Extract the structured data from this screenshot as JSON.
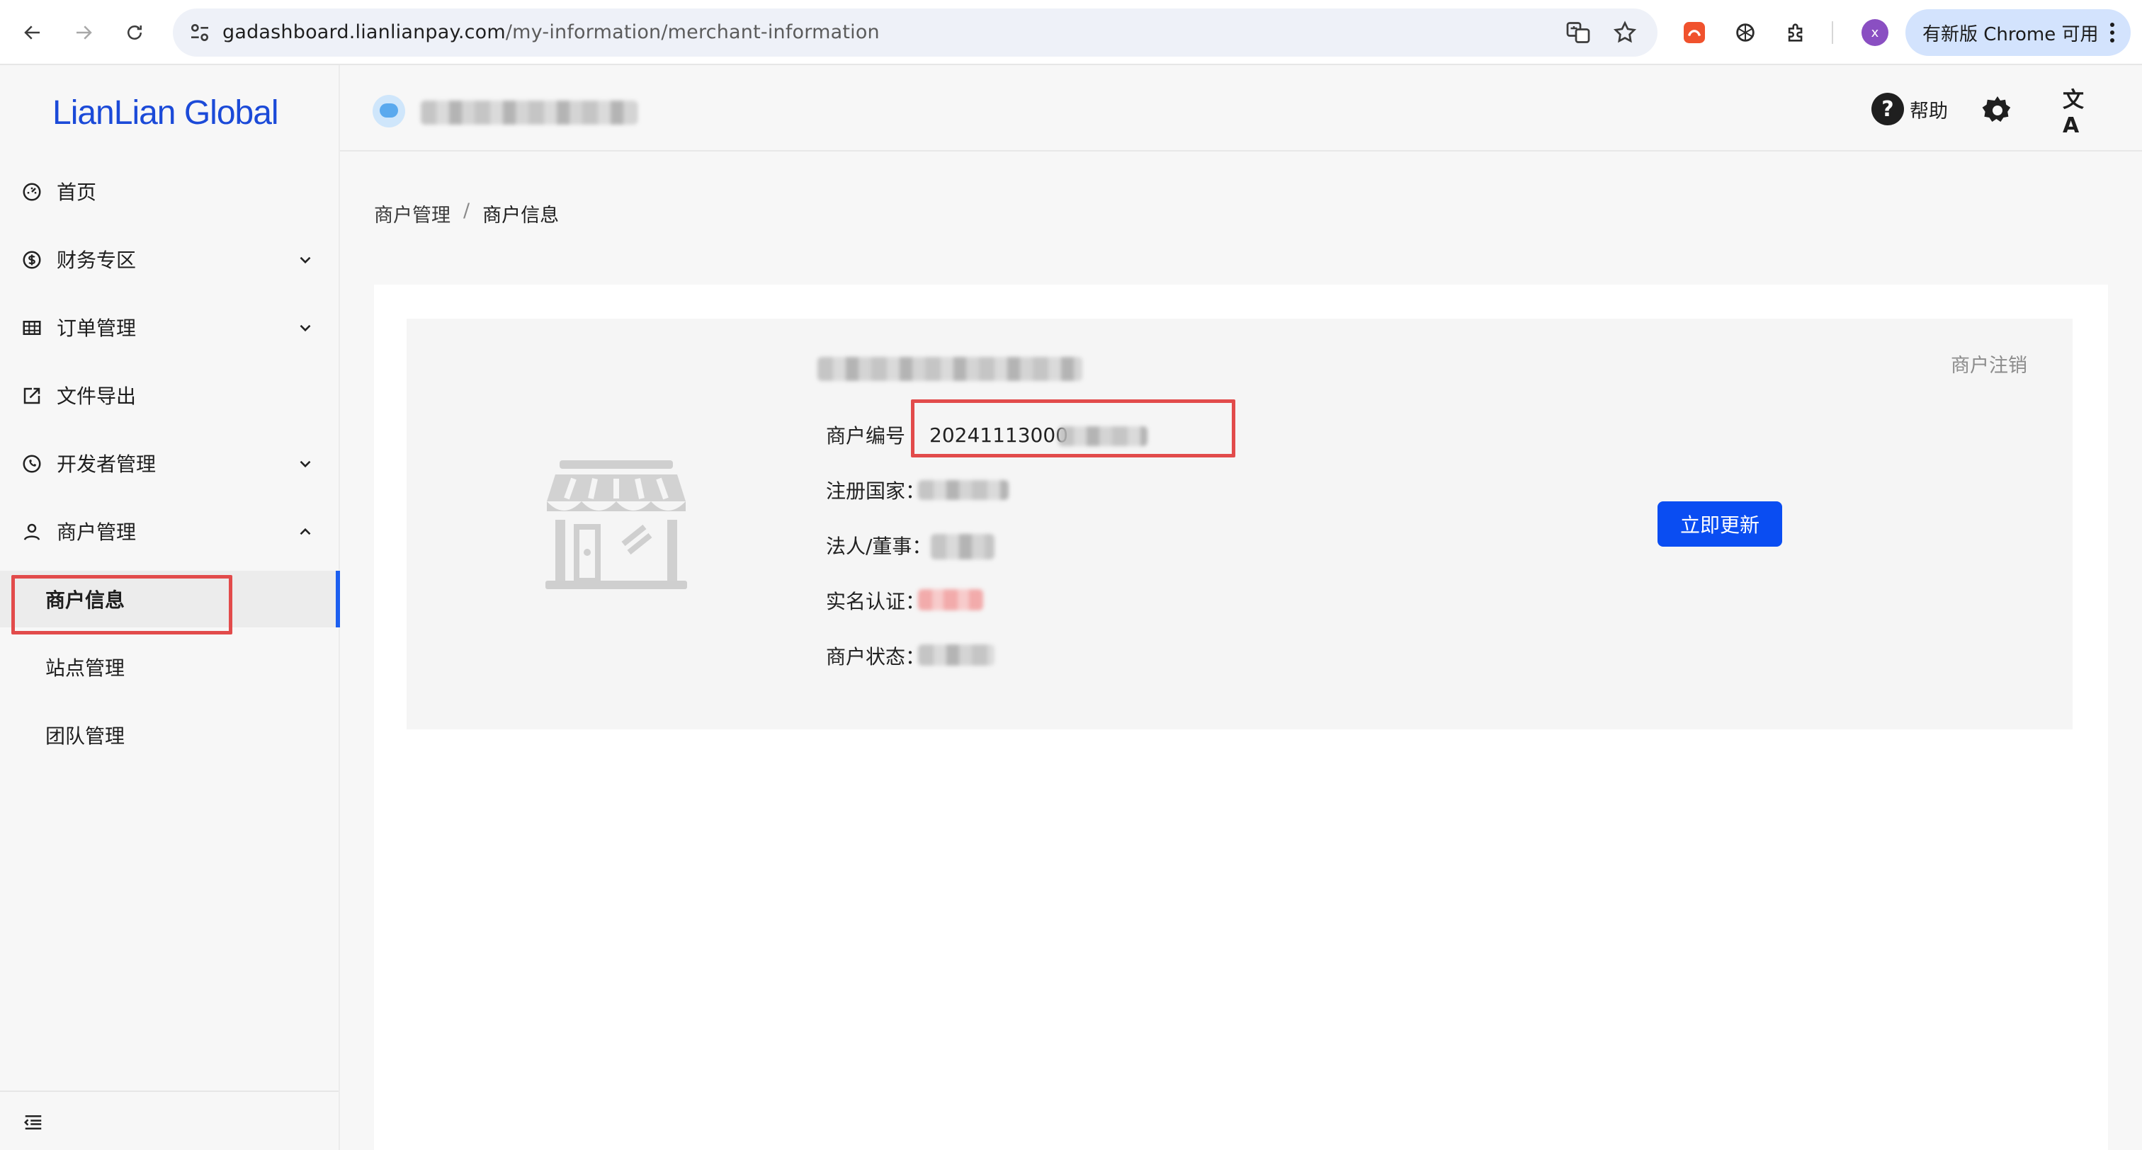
{
  "browser": {
    "url_host": "gadashboard.lianlianpay.com",
    "url_path": "/my-information/merchant-information",
    "update_label": "有新版 Chrome 可用",
    "profile_initial": "x"
  },
  "sidebar": {
    "logo": "LianLian Global",
    "items": [
      {
        "label": "首页",
        "icon": "dashboard-icon"
      },
      {
        "label": "财务专区",
        "icon": "dollar-icon"
      },
      {
        "label": "订单管理",
        "icon": "table-icon"
      },
      {
        "label": "文件导出",
        "icon": "export-icon"
      },
      {
        "label": "开发者管理",
        "icon": "phone-circle-icon"
      },
      {
        "label": "商户管理",
        "icon": "user-icon"
      }
    ],
    "sub_items": [
      {
        "label": "商户信息",
        "active": true
      },
      {
        "label": "站点管理"
      },
      {
        "label": "团队管理"
      }
    ]
  },
  "header": {
    "help_label": "帮助",
    "help_symbol": "?",
    "translate_symbol": "文A"
  },
  "breadcrumb": {
    "parent": "商户管理",
    "separator": "/",
    "current": "商户信息"
  },
  "merchant": {
    "cancel_label": "商户注销",
    "update_button": "立即更新",
    "fields": {
      "id_label": "商户编号",
      "id_value": "20241113000",
      "country_label": "注册国家：",
      "legal_label": "法人/董事：",
      "verify_label": "实名认证：",
      "status_label": "商户状态："
    }
  },
  "colors": {
    "brand": "#1b4ad8",
    "primary_button": "#0a4df2",
    "highlight": "#e24b4b",
    "active_bar": "#1c5ff0"
  }
}
